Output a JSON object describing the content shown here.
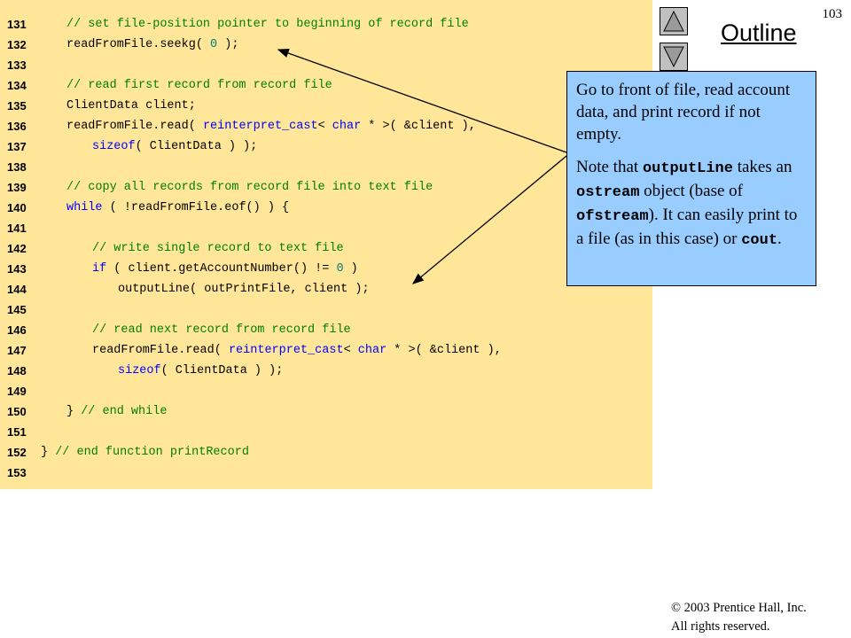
{
  "slide": {
    "number": "103",
    "outline_title": "Outline"
  },
  "code_lines": [
    {
      "num": "131",
      "indent": 1,
      "tokens": [
        {
          "t": "// set file-position pointer to beginning of record file",
          "c": "comment"
        }
      ]
    },
    {
      "num": "132",
      "indent": 1,
      "tokens": [
        {
          "t": "readFromFile.seekg( ",
          "c": ""
        },
        {
          "t": "0",
          "c": "number"
        },
        {
          "t": " );",
          "c": ""
        }
      ]
    },
    {
      "num": "133",
      "indent": 0,
      "tokens": []
    },
    {
      "num": "134",
      "indent": 1,
      "tokens": [
        {
          "t": "// read first record from record file",
          "c": "comment"
        }
      ]
    },
    {
      "num": "135",
      "indent": 1,
      "tokens": [
        {
          "t": "ClientData client;",
          "c": ""
        }
      ]
    },
    {
      "num": "136",
      "indent": 1,
      "tokens": [
        {
          "t": "readFromFile.read( ",
          "c": ""
        },
        {
          "t": "reinterpret_cast",
          "c": "keyword"
        },
        {
          "t": "< ",
          "c": ""
        },
        {
          "t": "char",
          "c": "keyword"
        },
        {
          "t": " * >( &client ),",
          "c": ""
        }
      ]
    },
    {
      "num": "137",
      "indent": 2,
      "tokens": [
        {
          "t": "sizeof",
          "c": "keyword"
        },
        {
          "t": "( ClientData ) );",
          "c": ""
        }
      ]
    },
    {
      "num": "138",
      "indent": 0,
      "tokens": []
    },
    {
      "num": "139",
      "indent": 1,
      "tokens": [
        {
          "t": "// copy all records from record file into text file",
          "c": "comment"
        }
      ]
    },
    {
      "num": "140",
      "indent": 1,
      "tokens": [
        {
          "t": "while",
          "c": "keyword"
        },
        {
          "t": " ( !readFromFile.eof() ) {",
          "c": ""
        }
      ]
    },
    {
      "num": "141",
      "indent": 0,
      "tokens": []
    },
    {
      "num": "142",
      "indent": 2,
      "tokens": [
        {
          "t": "// write single record to text file",
          "c": "comment"
        }
      ]
    },
    {
      "num": "143",
      "indent": 2,
      "tokens": [
        {
          "t": "if",
          "c": "keyword"
        },
        {
          "t": " ( client.getAccountNumber() != ",
          "c": ""
        },
        {
          "t": "0",
          "c": "number"
        },
        {
          "t": " )",
          "c": ""
        }
      ]
    },
    {
      "num": "144",
      "indent": 3,
      "tokens": [
        {
          "t": "outputLine( outPrintFile, client );",
          "c": ""
        }
      ]
    },
    {
      "num": "145",
      "indent": 0,
      "tokens": []
    },
    {
      "num": "146",
      "indent": 2,
      "tokens": [
        {
          "t": "// read next record from record file",
          "c": "comment"
        }
      ]
    },
    {
      "num": "147",
      "indent": 2,
      "tokens": [
        {
          "t": "readFromFile.read( ",
          "c": ""
        },
        {
          "t": "reinterpret_cast",
          "c": "keyword"
        },
        {
          "t": "< ",
          "c": ""
        },
        {
          "t": "char",
          "c": "keyword"
        },
        {
          "t": " * >( &client ),",
          "c": ""
        }
      ]
    },
    {
      "num": "148",
      "indent": 3,
      "tokens": [
        {
          "t": "sizeof",
          "c": "keyword"
        },
        {
          "t": "( ClientData ) );",
          "c": ""
        }
      ]
    },
    {
      "num": "149",
      "indent": 0,
      "tokens": []
    },
    {
      "num": "150",
      "indent": 1,
      "tokens": [
        {
          "t": "} ",
          "c": ""
        },
        {
          "t": "// end while",
          "c": "comment"
        }
      ]
    },
    {
      "num": "151",
      "indent": 0,
      "tokens": []
    },
    {
      "num": "152",
      "indent": 0,
      "tokens": [
        {
          "t": "} ",
          "c": ""
        },
        {
          "t": "// end function printRecord",
          "c": "comment"
        }
      ]
    },
    {
      "num": "153",
      "indent": 0,
      "tokens": []
    }
  ],
  "callout": {
    "p1": "Go to front of file, read account data, and print record if not empty.",
    "p2_a": "Note that ",
    "p2_code1": "outputLine",
    "p2_b": " takes an ",
    "p2_code2": "ostream",
    "p2_c": " object (base of ",
    "p2_code3": "ofstream",
    "p2_d": "). It can easily print to a file (as in this case) or ",
    "p2_code4": "cout",
    "p2_e": "."
  },
  "nav": {
    "up_icon": "triangle-up-icon",
    "down_icon": "triangle-down-icon"
  },
  "footer": {
    "copyright": "© 2003 Prentice Hall, Inc.",
    "rights": "All rights reserved."
  },
  "colors": {
    "code_background": "#ffe699",
    "callout_background": "#99ccff",
    "comment": "#008000",
    "keyword": "#0000ff",
    "number": "#008080"
  }
}
